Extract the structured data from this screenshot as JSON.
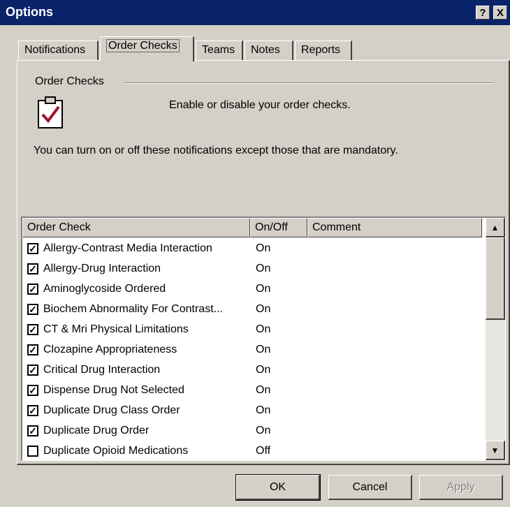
{
  "window": {
    "title": "Options",
    "help_label": "?",
    "close_label": "X"
  },
  "tabs": [
    {
      "label": "Notifications",
      "active": false
    },
    {
      "label": "Order Checks",
      "active": true
    },
    {
      "label": "Teams",
      "active": false
    },
    {
      "label": "Notes",
      "active": false
    },
    {
      "label": "Reports",
      "active": false
    }
  ],
  "group": {
    "label": "Order Checks",
    "icon": "clipboard-check-icon",
    "description": "Enable or disable your order checks.",
    "info": "You can turn on or off these notifications except those that are mandatory."
  },
  "list": {
    "columns": [
      "Order Check",
      "On/Off",
      "Comment"
    ],
    "rows": [
      {
        "name": "Allergy-Contrast Media Interaction",
        "status": "On",
        "checked": true
      },
      {
        "name": "Allergy-Drug Interaction",
        "status": "On",
        "checked": true
      },
      {
        "name": "Aminoglycoside Ordered",
        "status": "On",
        "checked": true
      },
      {
        "name": "Biochem Abnormality For Contrast...",
        "status": "On",
        "checked": true
      },
      {
        "name": "CT & Mri Physical Limitations",
        "status": "On",
        "checked": true
      },
      {
        "name": "Clozapine Appropriateness",
        "status": "On",
        "checked": true
      },
      {
        "name": "Critical Drug Interaction",
        "status": "On",
        "checked": true
      },
      {
        "name": "Dispense Drug Not Selected",
        "status": "On",
        "checked": true
      },
      {
        "name": "Duplicate Drug Class Order",
        "status": "On",
        "checked": true
      },
      {
        "name": "Duplicate Drug Order",
        "status": "On",
        "checked": true
      },
      {
        "name": "Duplicate Opioid Medications",
        "status": "Off",
        "checked": false
      }
    ]
  },
  "buttons": {
    "ok": "OK",
    "cancel": "Cancel",
    "apply": "Apply"
  },
  "colors": {
    "titlebar": "#0a246a",
    "face": "#d4d0c8",
    "check_mark_icon": "#a0142a"
  }
}
